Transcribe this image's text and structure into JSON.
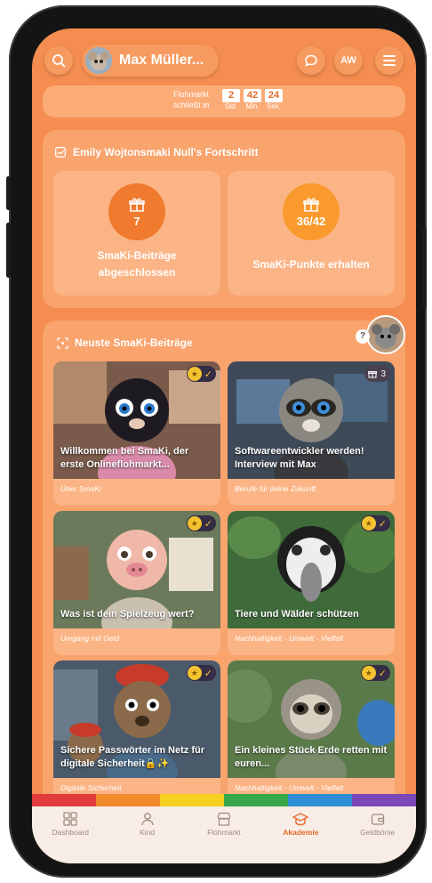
{
  "topbar": {
    "user_name": "Max Müller...",
    "initials": "AW",
    "icons": [
      "search-icon",
      "chat-icon",
      "menu-icon"
    ]
  },
  "timer": {
    "label_line1": "Flohmarkt",
    "label_line2": "schließt in",
    "hours": "2",
    "minutes": "42",
    "seconds": "24",
    "unit_hours": "Std.",
    "unit_minutes": "Min.",
    "unit_seconds": "Sek."
  },
  "progress": {
    "title": "Emily Wojtonsmaki Null's Fortschritt",
    "stats": [
      {
        "value": "7",
        "label": "SmaKi-Beiträge abgeschlossen"
      },
      {
        "value": "36/42",
        "label": "SmaKi-Punkte erhalten"
      }
    ]
  },
  "posts": {
    "title": "Neuste SmaKi-Beiträge",
    "help_badge": "?",
    "gift_count": "3",
    "cards": [
      {
        "title": "Willkommen bei SmaKi, der erste Onlineflohmarkt...",
        "category": "Über SmaKi"
      },
      {
        "title": "Softwareentwickler werden! Interview mit Max",
        "category": "Berufe für deine Zukunft"
      },
      {
        "title": "Was ist dein Spielzeug wert?",
        "category": "Umgang mit Geld"
      },
      {
        "title": "Tiere und Wälder schützen",
        "category": "Nachhaltigkeit - Umwelt - Vielfalt"
      },
      {
        "title": "Sichere Passwörter im Netz für digitale Sicherheit🔒✨",
        "category": "Digitale Sicherheit"
      },
      {
        "title": "Ein kleines Stück Erde retten mit euren...",
        "category": "Nachhaltigkeit - Umwelt - Vielfalt"
      }
    ]
  },
  "nav": {
    "items": [
      {
        "label": "Dashboard",
        "icon": "dashboard-icon"
      },
      {
        "label": "Kind",
        "icon": "person-icon"
      },
      {
        "label": "Flohmarkt",
        "icon": "store-icon"
      },
      {
        "label": "Akademie",
        "icon": "graduation-cap-icon"
      },
      {
        "label": "Geldbörse",
        "icon": "wallet-icon"
      }
    ],
    "active": "Akademie",
    "rainbow_colors": [
      "#e23b3b",
      "#f08a2c",
      "#f5d021",
      "#37a84a",
      "#2f8fd6",
      "#7a48b8"
    ]
  }
}
